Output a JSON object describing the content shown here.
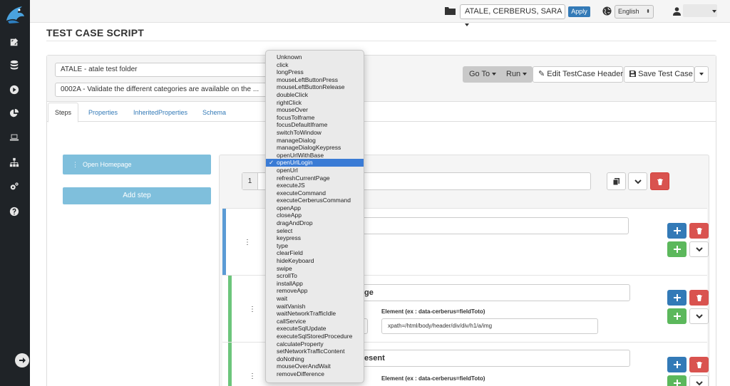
{
  "topbar": {
    "system_selector": "ATALE, CERBERUS, SARA",
    "apply_label": "Apply",
    "language": "English"
  },
  "page": {
    "title": "TEST CASE SCRIPT"
  },
  "header": {
    "folder_select": "ATALE - atale test folder",
    "testcase_select": "0002A - Validate the different categories are available on the ...",
    "goto_label": "Go To",
    "run_label": "Run",
    "edit_header_label": "Edit TestCase Header",
    "save_label": "Save Test Case"
  },
  "tabs": [
    {
      "label": "Steps",
      "active": true
    },
    {
      "label": "Properties",
      "active": false
    },
    {
      "label": "InheritedProperties",
      "active": false
    },
    {
      "label": "Schema",
      "active": false
    }
  ],
  "steps_list": {
    "items": [
      {
        "label": "Open Homepage"
      }
    ],
    "add_step_label": "Add step"
  },
  "editor": {
    "step_number": "1",
    "actions": [
      {
        "visible_text": "",
        "color": "#5b9bd5"
      },
      {
        "visible_text": "ge",
        "element_label": "Element (ex : data-cerberus=fieldToto)",
        "element_value": "xpath=/html/body/header/div/div/h1/a/img",
        "color": "#6cc57b"
      },
      {
        "visible_text": "esent",
        "element_label": "Element (ex : data-cerberus=fieldToto)",
        "color": "#6cc57b"
      }
    ]
  },
  "action_dropdown": {
    "selected": "openUrlLogin",
    "options": [
      "Unknown",
      "click",
      "longPress",
      "mouseLeftButtonPress",
      "mouseLeftButtonRelease",
      "doubleClick",
      "rightClick",
      "mouseOver",
      "focusToIframe",
      "focusDefaultIframe",
      "switchToWindow",
      "manageDialog",
      "manageDialogKeypress",
      "openUrlWithBase",
      "openUrlLogin",
      "openUrl",
      "refreshCurrentPage",
      "executeJS",
      "executeCommand",
      "executeCerberusCommand",
      "openApp",
      "closeApp",
      "dragAndDrop",
      "select",
      "keypress",
      "type",
      "clearField",
      "hideKeyboard",
      "swipe",
      "scrollTo",
      "installApp",
      "removeApp",
      "wait",
      "waitVanish",
      "waitNetworkTrafficIdle",
      "callService",
      "executeSqlUpdate",
      "executeSqlStoredProcedure",
      "calculateProperty",
      "setNetworkTrafficContent",
      "doNothing",
      "mouseOverAndWait",
      "removeDifference"
    ]
  },
  "colors": {
    "sidebar": "#1f2327",
    "primary": "#337ab7",
    "danger": "#d9534f",
    "success": "#5cb85c",
    "step_blue": "#7fbfdc"
  },
  "icons": [
    "logo",
    "edit-icon",
    "database-icon",
    "play-icon",
    "pie-chart-icon",
    "laptop-icon",
    "sitemap-icon",
    "gears-icon",
    "help-icon",
    "arrow-right-icon",
    "folder-icon",
    "globe-icon",
    "user-icon",
    "pencil-icon",
    "save-icon",
    "copy-icon",
    "chevron-down-icon",
    "trash-icon",
    "plus-icon"
  ]
}
